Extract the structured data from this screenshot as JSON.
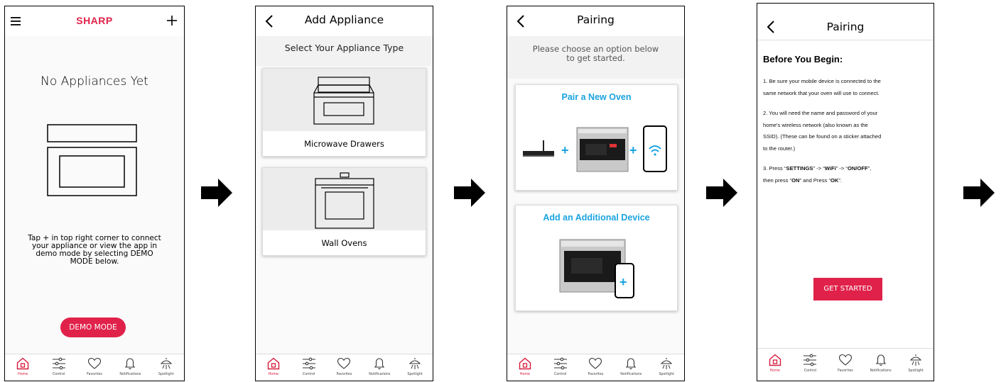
{
  "colors": {
    "brand": "#e0224a",
    "accent_blue": "#1aa3e0",
    "tab_active": "#d8193a"
  },
  "tabs": [
    "Home",
    "Control",
    "Favorites",
    "Notifications",
    "Spotlight"
  ],
  "screen1": {
    "logo": "SHARP",
    "heading": "No Appliances Yet",
    "instruction_lines": [
      "Tap + in top right corner to connect",
      "your appliance or view the app in",
      "demo mode by selecting DEMO",
      "MODE below."
    ],
    "demo_button": "DEMO MODE"
  },
  "screen2": {
    "title": "Add Appliance",
    "subtitle": "Select Your Appliance Type",
    "option1": "Microwave Drawers",
    "option2": "Wall Ovens"
  },
  "screen3": {
    "title": "Pairing",
    "intro_lines": [
      "Please choose an option below",
      "to get started."
    ],
    "option1": "Pair a New Oven",
    "option2": "Add an Additional Device"
  },
  "screen4": {
    "title": "Pairing",
    "heading": "Before You Begin:",
    "step1_lines": [
      "1. Be sure your mobile device is connected to the",
      "same network that your oven will use to connect."
    ],
    "step2_lines": [
      "2. You will need the name and password of your",
      "home's wireless network (also known as the",
      "SSID). (These can be found on a sticker attached",
      "to the router.)"
    ],
    "step3": {
      "prefix": "3. Press “",
      "settings": "SETTINGS",
      "arrow1": "” -> “",
      "wifi": "WiFi",
      "arrow2": "” -> “",
      "onoff": "ON/OFF",
      "line2_prefix": "”,",
      "then": "then press “",
      "on": "ON",
      "and": "” and Press “",
      "ok": "OK",
      "end": "”."
    },
    "button": "GET STARTED"
  }
}
